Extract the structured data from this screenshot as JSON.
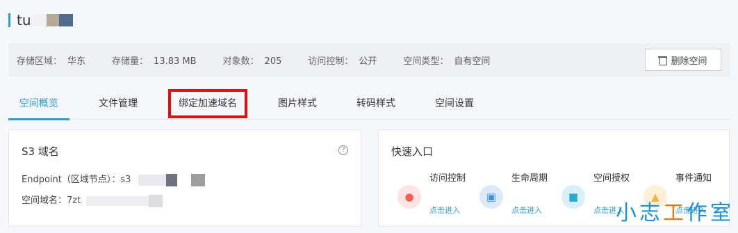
{
  "bucket": {
    "title": "tu"
  },
  "info": {
    "region_label": "存储区域：",
    "region_value": "华东",
    "storage_label": "存储量：",
    "storage_value": "13.83 MB",
    "objects_label": "对象数：",
    "objects_value": "205",
    "access_label": "访问控制：",
    "access_value": "公开",
    "type_label": "空间类型：",
    "type_value": "自有空间",
    "delete_label": "删除空间"
  },
  "tabs": [
    {
      "label": "空间概览"
    },
    {
      "label": "文件管理"
    },
    {
      "label": "绑定加速域名"
    },
    {
      "label": "图片样式"
    },
    {
      "label": "转码样式"
    },
    {
      "label": "空间设置"
    }
  ],
  "s3": {
    "title": "S3 域名",
    "help": "?",
    "endpoint_label": "Endpoint（区域节点）：",
    "endpoint_value": "s3",
    "domain_label": "空间域名：",
    "domain_value": "7zt"
  },
  "quick": {
    "title": "快速入口",
    "items": [
      {
        "label": "访问控制",
        "link": "点击进入",
        "color": "#f25c54",
        "icon": "user-lock-icon"
      },
      {
        "label": "生命周期",
        "link": "点击进入",
        "color": "#3d8fe0",
        "icon": "calendar-clock-icon"
      },
      {
        "label": "空间授权",
        "link": "点击进入",
        "color": "#2aa9d6",
        "icon": "box-key-icon"
      },
      {
        "label": "事件通知",
        "link": "点击进入",
        "color": "#f1b53a",
        "icon": "notice-icon"
      }
    ]
  },
  "watermark": {
    "text": "小志工作室"
  },
  "colors": {
    "accent": "#2a9fd6",
    "highlight": "#e01010"
  }
}
